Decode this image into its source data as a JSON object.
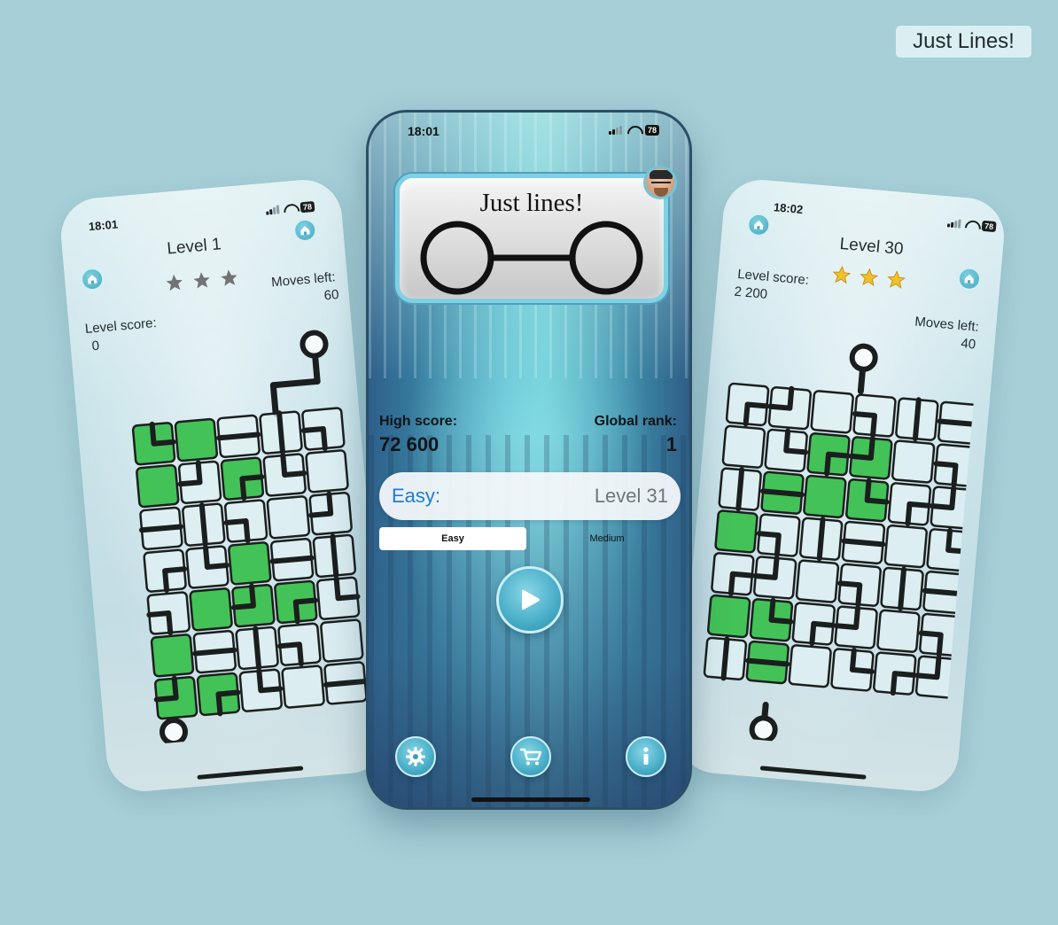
{
  "header": {
    "app_name": "Just Lines!"
  },
  "left_phone": {
    "time": "18:01",
    "battery": "78",
    "level_title": "Level 1",
    "stars_filled": 0,
    "stars_total": 3,
    "level_score_label": "Level score:",
    "level_score_value": "0",
    "moves_left_label": "Moves left:",
    "moves_left_value": "60",
    "home_icon": "home-icon"
  },
  "center_phone": {
    "time": "18:01",
    "battery": "78",
    "logo_title": "Just lines!",
    "high_score_label": "High score:",
    "high_score_value": "72 600",
    "global_rank_label": "Global rank:",
    "global_rank_value": "1",
    "difficulty_label": "Easy:",
    "current_level": "Level 31",
    "tabs": [
      {
        "label": "Easy",
        "selected": true
      },
      {
        "label": "Medium",
        "selected": false
      }
    ],
    "buttons": {
      "play": "play-icon",
      "settings": "gear-icon",
      "shop": "cart-icon",
      "info": "info-icon"
    }
  },
  "right_phone": {
    "time": "18:02",
    "battery": "78",
    "level_title": "Level 30",
    "stars_filled": 3,
    "stars_total": 3,
    "level_score_label": "Level score:",
    "level_score_value": "2 200",
    "moves_left_label": "Moves left:",
    "moves_left_value": "40",
    "home_icon": "home-icon"
  },
  "colors": {
    "background": "#a6cfd8",
    "tile_green": "#3cc24f",
    "tile_light": "#e6f4f6",
    "accent_blue": "#1f7bd8",
    "star_gold": "#f6c21c",
    "star_grey": "#6e6e6e"
  }
}
